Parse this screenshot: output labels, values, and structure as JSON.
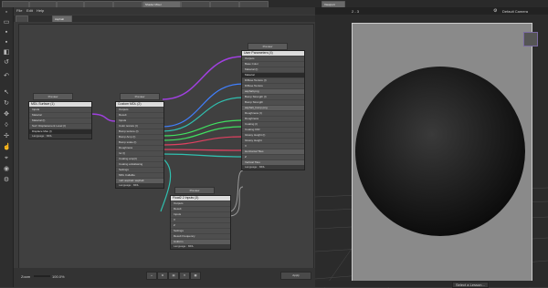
{
  "tabs": [
    {
      "label": "",
      "active": false
    },
    {
      "label": "",
      "active": false
    },
    {
      "label": "",
      "active": false
    },
    {
      "label": "",
      "active": false
    },
    {
      "label": "",
      "active": false
    },
    {
      "label": "Shader Mixer",
      "active": true
    },
    {
      "label": "",
      "active": false
    },
    {
      "label": "",
      "active": false
    },
    {
      "label": "",
      "active": false
    }
  ],
  "viewport_tab": "Viewport",
  "menu": [
    "File",
    "Edit",
    "Help"
  ],
  "editor_subtab": "Asphalt",
  "nodes": {
    "mdl_surface": {
      "preview": "Preview",
      "title": "MDL Surface (1)",
      "rows": [
        "Inputs",
        "Material",
        "Material (I)",
        "Surf. Displacement Level (I)",
        "Displace Max (I)"
      ],
      "footer": "Language : MDL"
    },
    "custom_mdl": {
      "preview": "Preview",
      "title": "Custom MDL (2)",
      "rows": [
        "Outputs",
        "Result",
        "Inputs",
        "Color texture (I)",
        "Bump texture (I)",
        "Bump Amp (I)",
        "Bump scale (I)",
        "Roughness",
        "Ior (I)",
        "Coating amp(I)",
        "Coating antialiasing",
        "Settings",
        "MDL Callable"
      ],
      "code": "mdl::asphalt::asphalt",
      "footer": "Language : MDL"
    },
    "user_params": {
      "preview": "Preview",
      "title": "User Parameters (4)",
      "rows": [
        "Outputs",
        "Base Color",
        "Material (I)",
        "Material",
        "Diffuse Texture (I)",
        "Diffuse Texture",
        "asphalt.png",
        "Bump Strength (I)",
        "Bump Strength",
        "asphalt_bump.png",
        "Roughness (I)",
        "Roughness",
        "Coating (I)",
        "Coating IOR",
        "Glossy Height (I)",
        "Glossy Height",
        "V",
        "Horizontal Tiles",
        "Z",
        "Vertical Tiles"
      ],
      "footer": "Language : MDL"
    },
    "float2": {
      "preview": "Preview",
      "title": "Float2 2 Inputs (3)",
      "rows": [
        "Outputs",
        "Result",
        "Inputs",
        "V",
        "Z",
        "Settings",
        "Result Frequency",
        "Uniform"
      ],
      "footer": "Language : MDL"
    }
  },
  "zoom_label": "Zoom",
  "zoom_value": "100.0%",
  "apply_button": "Apply",
  "viewport": {
    "camera_label": "2 - 3",
    "camera_select": "Default Camera",
    "status_select": "Select a Lesson..."
  },
  "colors": {
    "accent_purple": "#a040e0",
    "wire_teal": "#30c0b0",
    "wire_red": "#e04060",
    "wire_green": "#40e060",
    "wire_blue": "#4080ff",
    "wire_gray": "#9a9a9a"
  }
}
